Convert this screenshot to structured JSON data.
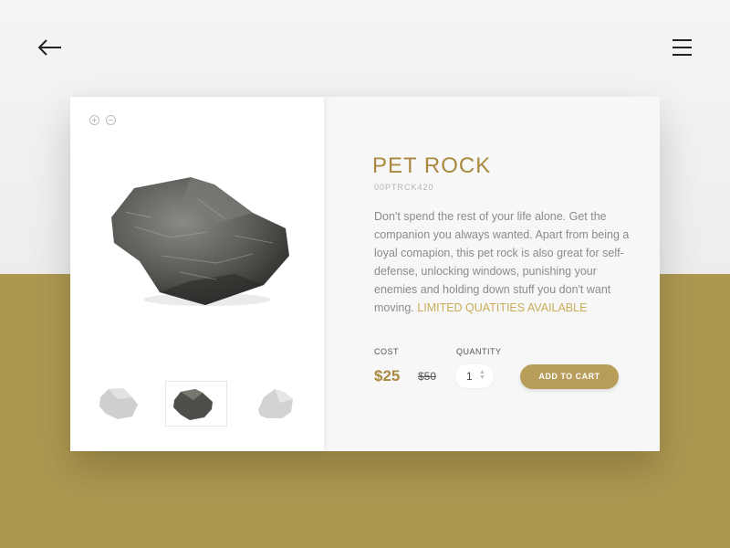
{
  "nav": {
    "back_icon": "arrow-left-icon",
    "menu_icon": "hamburger-menu-icon"
  },
  "gallery": {
    "zoom_in_icon": "zoom-in-icon",
    "zoom_out_icon": "zoom-out-icon",
    "selected_thumbnail": 2
  },
  "product": {
    "title": "PET ROCK",
    "sku": "00PTRCK420",
    "description": "Don't spend the rest of your life alone. Get the companion you always wanted. Apart from being a loyal comapion, this pet rock is also great for self-defense, unlocking windows, punishing your enemies and holding down stuff you don't want moving.",
    "limited_note": "LIMITED QUATITIES AVAILABLE",
    "cost_label": "COST",
    "price": "$25",
    "old_price": "$50",
    "quantity_label": "QUANTITY",
    "quantity": "1",
    "add_to_cart": "ADD TO CART"
  },
  "colors": {
    "accent": "#a8893f",
    "button": "#b89d5a",
    "band": "#ad9850",
    "limited": "#c9ad59"
  }
}
